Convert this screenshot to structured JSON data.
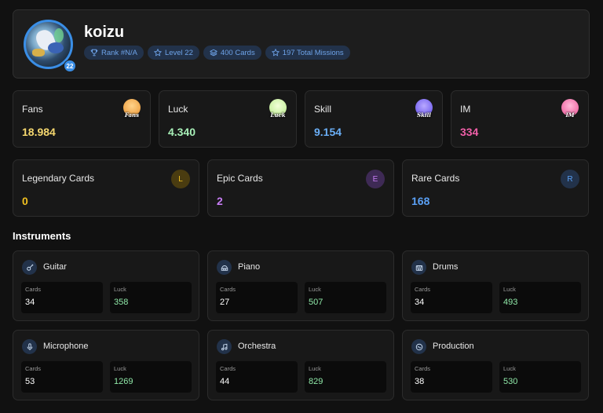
{
  "profile": {
    "username": "koizu",
    "level_badge": "22",
    "tags": [
      {
        "icon": "trophy-icon",
        "label": "Rank #N/A"
      },
      {
        "icon": "star-icon",
        "label": "Level 22"
      },
      {
        "icon": "layers-icon",
        "label": "400 Cards"
      },
      {
        "icon": "star-icon",
        "label": "197 Total Missions"
      }
    ]
  },
  "stats": [
    {
      "label": "Fans",
      "value": "18.984",
      "icon_text": "Fans",
      "color": "#f5d76e"
    },
    {
      "label": "Luck",
      "value": "4.340",
      "icon_text": "Luck",
      "color": "#a8f0b8"
    },
    {
      "label": "Skill",
      "value": "9.154",
      "icon_text": "Skill",
      "color": "#6aaef5"
    },
    {
      "label": "IM",
      "value": "334",
      "icon_text": "IM",
      "color": "#f05fa8"
    }
  ],
  "rarities": [
    {
      "label": "Legendary Cards",
      "value": "0",
      "letter": "L",
      "color": "#f0c020"
    },
    {
      "label": "Epic Cards",
      "value": "2",
      "letter": "E",
      "color": "#c77df5"
    },
    {
      "label": "Rare Cards",
      "value": "168",
      "letter": "R",
      "color": "#5aa0f5"
    }
  ],
  "instruments_title": "Instruments",
  "instruments": [
    {
      "name": "Guitar",
      "icon": "guitar-icon",
      "cards_label": "Cards",
      "cards": "34",
      "luck_label": "Luck",
      "luck": "358"
    },
    {
      "name": "Piano",
      "icon": "piano-icon",
      "cards_label": "Cards",
      "cards": "27",
      "luck_label": "Luck",
      "luck": "507"
    },
    {
      "name": "Drums",
      "icon": "drum-icon",
      "cards_label": "Cards",
      "cards": "34",
      "luck_label": "Luck",
      "luck": "493"
    },
    {
      "name": "Microphone",
      "icon": "microphone-icon",
      "cards_label": "Cards",
      "cards": "53",
      "luck_label": "Luck",
      "luck": "1269"
    },
    {
      "name": "Orchestra",
      "icon": "music-note-icon",
      "cards_label": "Cards",
      "cards": "44",
      "luck_label": "Luck",
      "luck": "829"
    },
    {
      "name": "Production",
      "icon": "disc-icon",
      "cards_label": "Cards",
      "cards": "38",
      "luck_label": "Luck",
      "luck": "530"
    }
  ]
}
